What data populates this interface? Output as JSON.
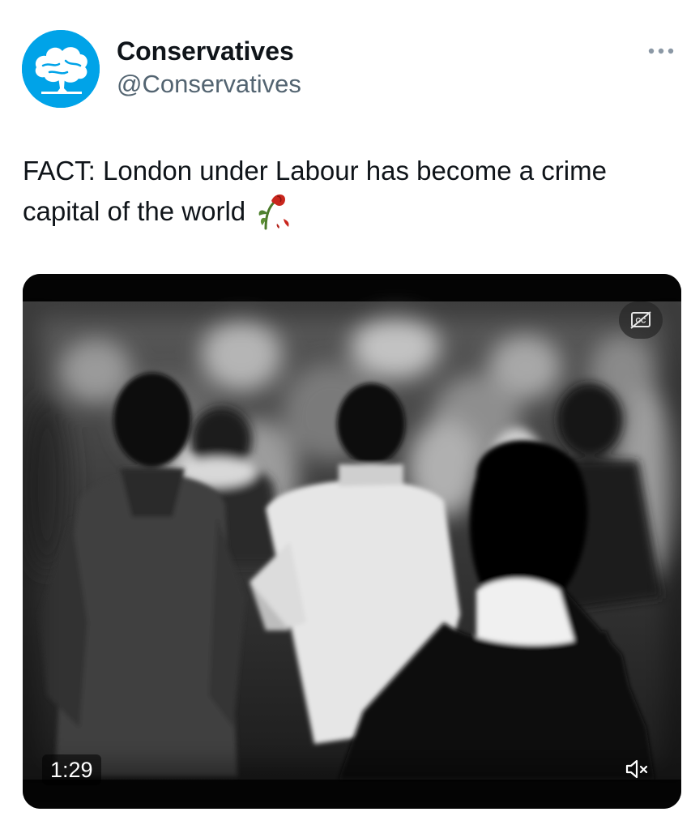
{
  "account": {
    "display_name": "Conservatives",
    "handle": "@Conservatives",
    "avatar_icon": "oak-tree-logo-icon",
    "avatar_color": "#00a3e8"
  },
  "tweet": {
    "text": "FACT: London under Labour has become a crime capital of the world",
    "emoji": "wilted-flower-icon"
  },
  "video": {
    "duration": "1:29",
    "captions_icon": "captions-off-icon",
    "mute_icon": "muted-speaker-icon"
  },
  "menu": {
    "more_icon": "more-dots-icon"
  },
  "colors": {
    "text_primary": "#0f1419",
    "text_secondary": "#536471",
    "brand": "#00a3e8"
  }
}
